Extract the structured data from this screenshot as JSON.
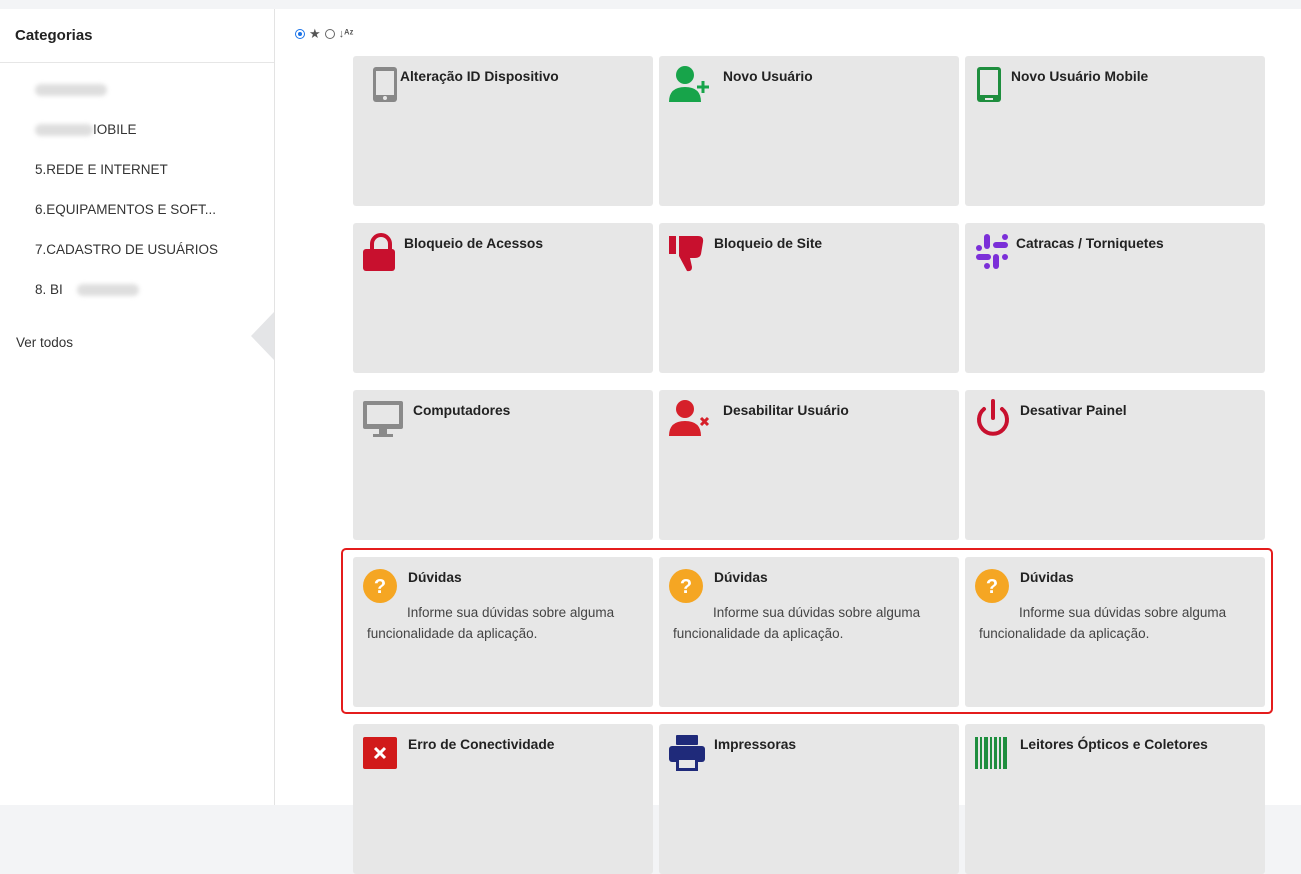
{
  "sidebar": {
    "title": "Categorias",
    "items": [
      {
        "label": ""
      },
      {
        "label": "IOBILE"
      },
      {
        "label": "5.REDE E INTERNET"
      },
      {
        "label": "6.EQUIPAMENTOS E SOFT..."
      },
      {
        "label": "7.CADASTRO DE USUÁRIOS"
      },
      {
        "label": "8. BI"
      }
    ],
    "ver_todos": "Ver todos"
  },
  "cards": [
    {
      "title": "Alteração ID Dispositivo",
      "icon": "tablet-icon",
      "color": "#888888",
      "desc": ""
    },
    {
      "title": "Novo Usuário",
      "icon": "user-add-icon",
      "color": "#17a44a",
      "desc": ""
    },
    {
      "title": "Novo Usuário Mobile",
      "icon": "mobile-phone-icon",
      "color": "#1e8e3e",
      "desc": ""
    },
    {
      "title": "Bloqueio de Acessos",
      "icon": "lock-icon",
      "color": "#c8102e",
      "desc": ""
    },
    {
      "title": "Bloqueio de Site",
      "icon": "thumbs-down-icon",
      "color": "#c8102e",
      "desc": ""
    },
    {
      "title": "Catracas / Torniquetes",
      "icon": "slack-icon",
      "color": "#7b2fd8",
      "desc": ""
    },
    {
      "title": "Computadores",
      "icon": "monitor-icon",
      "color": "#8a8a8a",
      "desc": ""
    },
    {
      "title": "Desabilitar Usuário",
      "icon": "user-remove-icon",
      "color": "#d6202a",
      "desc": ""
    },
    {
      "title": "Desativar Painel",
      "icon": "power-icon",
      "color": "#c8102e",
      "desc": ""
    },
    {
      "title": "Dúvidas",
      "icon": "question-icon",
      "color": "#f5a623",
      "desc": "Informe sua dúvidas sobre alguma funcionalidade da aplicação."
    },
    {
      "title": "Dúvidas",
      "icon": "question-icon",
      "color": "#f5a623",
      "desc": "Informe sua dúvidas sobre alguma funcionalidade da aplicação."
    },
    {
      "title": "Dúvidas",
      "icon": "question-icon",
      "color": "#f5a623",
      "desc": "Informe sua dúvidas sobre alguma funcionalidade da aplicação."
    },
    {
      "title": "Erro de Conectividade",
      "icon": "error-x-icon",
      "color": "#d11a1a",
      "desc": ""
    },
    {
      "title": "Impressoras",
      "icon": "printer-icon",
      "color": "#1f2a7a",
      "desc": ""
    },
    {
      "title": "Leitores Ópticos e Coletores",
      "icon": "barcode-icon",
      "color": "#1e8e3e",
      "desc": ""
    }
  ],
  "colors": {
    "highlight": "#e41c1c",
    "radio_selected": "#1a73e8",
    "card_bg": "#e7e7e7"
  }
}
